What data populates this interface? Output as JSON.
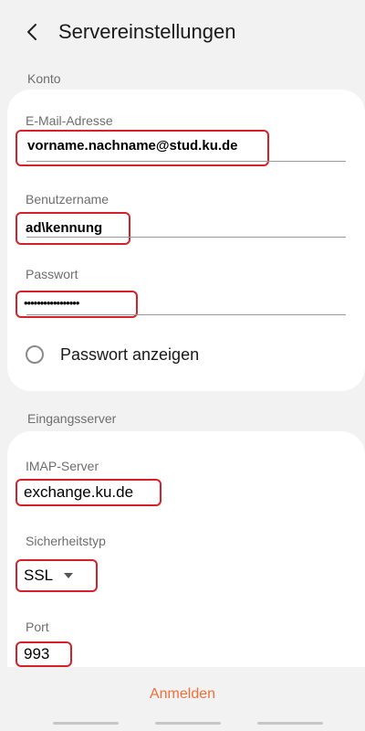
{
  "header": {
    "title": "Servereinstellungen"
  },
  "account": {
    "section_label": "Konto",
    "email": {
      "label": "E-Mail-Adresse",
      "value": "vorname.nachname@stud.ku.de"
    },
    "username": {
      "label": "Benutzername",
      "value": "ad\\kennung"
    },
    "password": {
      "label": "Passwort",
      "value": "•••••••••••••••••"
    },
    "show_password": {
      "label": "Passwort anzeigen",
      "checked": false
    }
  },
  "incoming": {
    "section_label": "Eingangsserver",
    "imap": {
      "label": "IMAP-Server",
      "value": "exchange.ku.de"
    },
    "security": {
      "label": "Sicherheitstyp",
      "value": "SSL"
    },
    "port": {
      "label": "Port",
      "value": "993"
    }
  },
  "footer": {
    "login_label": "Anmelden"
  },
  "colors": {
    "highlight": "#d8202a",
    "accent": "#f0703a"
  }
}
